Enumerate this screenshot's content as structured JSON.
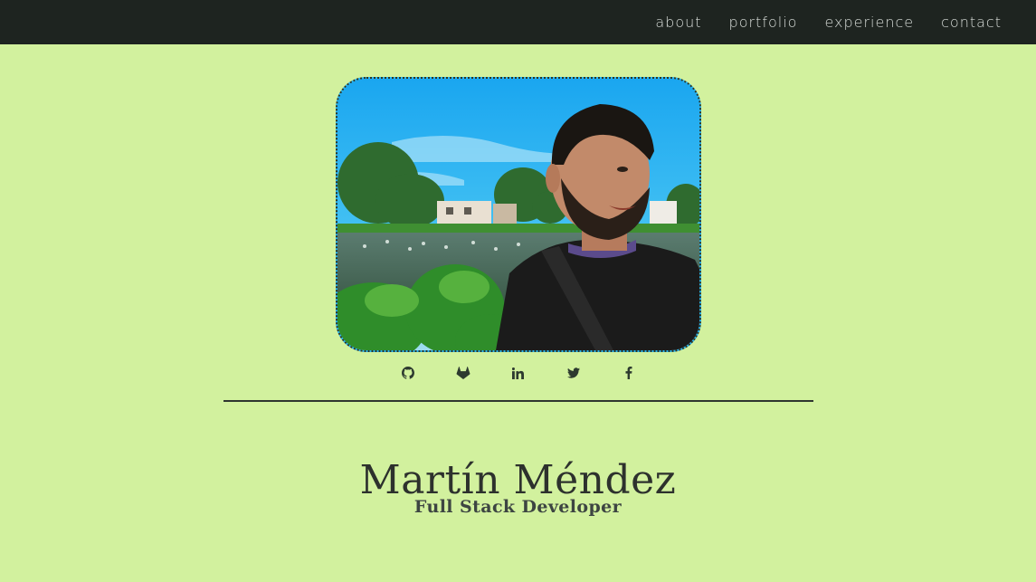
{
  "header": {
    "nav": [
      {
        "label": "about"
      },
      {
        "label": "portfolio"
      },
      {
        "label": "experience"
      },
      {
        "label": "contact"
      }
    ]
  },
  "profile": {
    "photo_icon": "profile-photo",
    "name": "Martín Méndez",
    "role": "Full Stack Developer"
  },
  "social": {
    "links": [
      {
        "icon": "github-icon"
      },
      {
        "icon": "gitlab-icon"
      },
      {
        "icon": "linkedin-icon"
      },
      {
        "icon": "twitter-icon"
      },
      {
        "icon": "facebook-icon"
      }
    ]
  },
  "colors": {
    "page_bg": "#d2f19e",
    "topbar_bg": "#1e2420",
    "text_dark": "#2d312d"
  }
}
